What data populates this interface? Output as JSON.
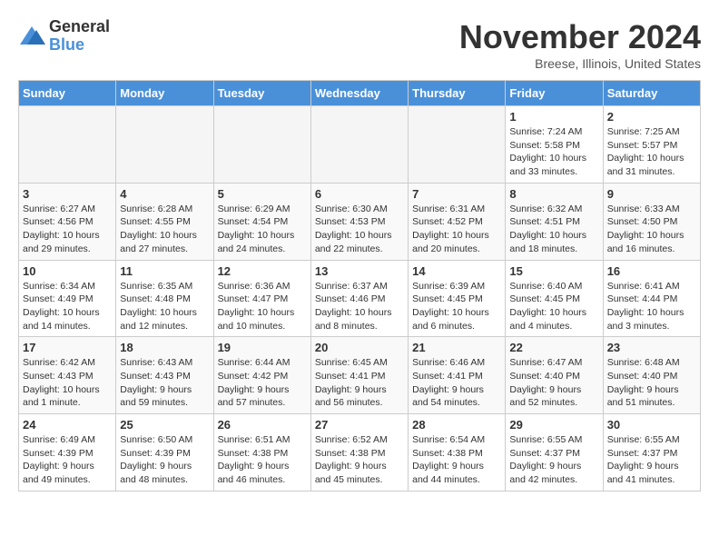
{
  "header": {
    "logo_general": "General",
    "logo_blue": "Blue",
    "month_title": "November 2024",
    "location": "Breese, Illinois, United States"
  },
  "weekdays": [
    "Sunday",
    "Monday",
    "Tuesday",
    "Wednesday",
    "Thursday",
    "Friday",
    "Saturday"
  ],
  "weeks": [
    [
      {
        "day": "",
        "info": ""
      },
      {
        "day": "",
        "info": ""
      },
      {
        "day": "",
        "info": ""
      },
      {
        "day": "",
        "info": ""
      },
      {
        "day": "",
        "info": ""
      },
      {
        "day": "1",
        "info": "Sunrise: 7:24 AM\nSunset: 5:58 PM\nDaylight: 10 hours\nand 33 minutes."
      },
      {
        "day": "2",
        "info": "Sunrise: 7:25 AM\nSunset: 5:57 PM\nDaylight: 10 hours\nand 31 minutes."
      }
    ],
    [
      {
        "day": "3",
        "info": "Sunrise: 6:27 AM\nSunset: 4:56 PM\nDaylight: 10 hours\nand 29 minutes."
      },
      {
        "day": "4",
        "info": "Sunrise: 6:28 AM\nSunset: 4:55 PM\nDaylight: 10 hours\nand 27 minutes."
      },
      {
        "day": "5",
        "info": "Sunrise: 6:29 AM\nSunset: 4:54 PM\nDaylight: 10 hours\nand 24 minutes."
      },
      {
        "day": "6",
        "info": "Sunrise: 6:30 AM\nSunset: 4:53 PM\nDaylight: 10 hours\nand 22 minutes."
      },
      {
        "day": "7",
        "info": "Sunrise: 6:31 AM\nSunset: 4:52 PM\nDaylight: 10 hours\nand 20 minutes."
      },
      {
        "day": "8",
        "info": "Sunrise: 6:32 AM\nSunset: 4:51 PM\nDaylight: 10 hours\nand 18 minutes."
      },
      {
        "day": "9",
        "info": "Sunrise: 6:33 AM\nSunset: 4:50 PM\nDaylight: 10 hours\nand 16 minutes."
      }
    ],
    [
      {
        "day": "10",
        "info": "Sunrise: 6:34 AM\nSunset: 4:49 PM\nDaylight: 10 hours\nand 14 minutes."
      },
      {
        "day": "11",
        "info": "Sunrise: 6:35 AM\nSunset: 4:48 PM\nDaylight: 10 hours\nand 12 minutes."
      },
      {
        "day": "12",
        "info": "Sunrise: 6:36 AM\nSunset: 4:47 PM\nDaylight: 10 hours\nand 10 minutes."
      },
      {
        "day": "13",
        "info": "Sunrise: 6:37 AM\nSunset: 4:46 PM\nDaylight: 10 hours\nand 8 minutes."
      },
      {
        "day": "14",
        "info": "Sunrise: 6:39 AM\nSunset: 4:45 PM\nDaylight: 10 hours\nand 6 minutes."
      },
      {
        "day": "15",
        "info": "Sunrise: 6:40 AM\nSunset: 4:45 PM\nDaylight: 10 hours\nand 4 minutes."
      },
      {
        "day": "16",
        "info": "Sunrise: 6:41 AM\nSunset: 4:44 PM\nDaylight: 10 hours\nand 3 minutes."
      }
    ],
    [
      {
        "day": "17",
        "info": "Sunrise: 6:42 AM\nSunset: 4:43 PM\nDaylight: 10 hours\nand 1 minute."
      },
      {
        "day": "18",
        "info": "Sunrise: 6:43 AM\nSunset: 4:43 PM\nDaylight: 9 hours\nand 59 minutes."
      },
      {
        "day": "19",
        "info": "Sunrise: 6:44 AM\nSunset: 4:42 PM\nDaylight: 9 hours\nand 57 minutes."
      },
      {
        "day": "20",
        "info": "Sunrise: 6:45 AM\nSunset: 4:41 PM\nDaylight: 9 hours\nand 56 minutes."
      },
      {
        "day": "21",
        "info": "Sunrise: 6:46 AM\nSunset: 4:41 PM\nDaylight: 9 hours\nand 54 minutes."
      },
      {
        "day": "22",
        "info": "Sunrise: 6:47 AM\nSunset: 4:40 PM\nDaylight: 9 hours\nand 52 minutes."
      },
      {
        "day": "23",
        "info": "Sunrise: 6:48 AM\nSunset: 4:40 PM\nDaylight: 9 hours\nand 51 minutes."
      }
    ],
    [
      {
        "day": "24",
        "info": "Sunrise: 6:49 AM\nSunset: 4:39 PM\nDaylight: 9 hours\nand 49 minutes."
      },
      {
        "day": "25",
        "info": "Sunrise: 6:50 AM\nSunset: 4:39 PM\nDaylight: 9 hours\nand 48 minutes."
      },
      {
        "day": "26",
        "info": "Sunrise: 6:51 AM\nSunset: 4:38 PM\nDaylight: 9 hours\nand 46 minutes."
      },
      {
        "day": "27",
        "info": "Sunrise: 6:52 AM\nSunset: 4:38 PM\nDaylight: 9 hours\nand 45 minutes."
      },
      {
        "day": "28",
        "info": "Sunrise: 6:54 AM\nSunset: 4:38 PM\nDaylight: 9 hours\nand 44 minutes."
      },
      {
        "day": "29",
        "info": "Sunrise: 6:55 AM\nSunset: 4:37 PM\nDaylight: 9 hours\nand 42 minutes."
      },
      {
        "day": "30",
        "info": "Sunrise: 6:55 AM\nSunset: 4:37 PM\nDaylight: 9 hours\nand 41 minutes."
      }
    ]
  ]
}
